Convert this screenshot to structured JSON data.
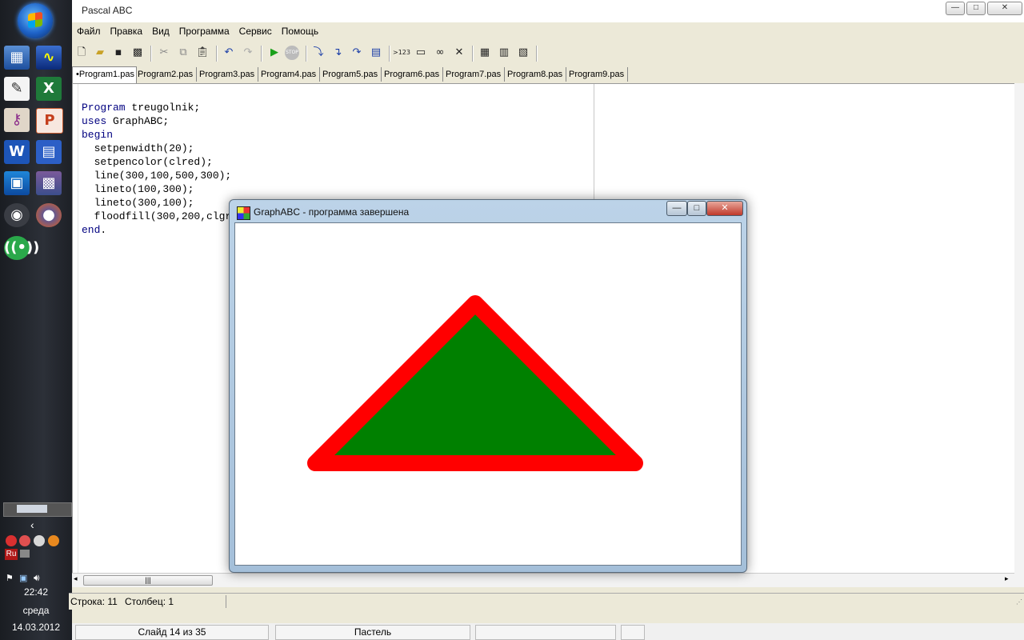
{
  "window": {
    "title": "Pascal ABC",
    "controls": {
      "minimize": "—",
      "maximize": "□",
      "close": "✕"
    }
  },
  "menu": [
    "Файл",
    "Правка",
    "Вид",
    "Программа",
    "Сервис",
    "Помощь"
  ],
  "toolbar": {
    "icons": [
      "new-file-icon",
      "open-folder-icon",
      "save-icon",
      "save-all-icon",
      "cut-icon",
      "copy-icon",
      "paste-icon",
      "undo-icon",
      "redo-icon",
      "run-icon",
      "stop-icon",
      "step-icon",
      "step-into-icon",
      "step-over-icon",
      "watch-icon",
      "eval-icon",
      "window-icon",
      "debug-icon",
      "close-icon",
      "format-icon",
      "compile-icon",
      "exe-icon"
    ],
    "label_123": ">123",
    "stop_label": "STOP"
  },
  "tabs": [
    "•Program1.pas",
    "Program2.pas",
    "Program3.pas",
    "Program4.pas",
    "Program5.pas",
    "Program6.pas",
    "Program7.pas",
    "Program8.pas",
    "Program9.pas"
  ],
  "editor": {
    "lines": [
      {
        "kw": "Program",
        "text": " treugolnik;"
      },
      {
        "kw": "uses",
        "text": " GraphABC;"
      },
      {
        "kw": "begin",
        "text": ""
      },
      {
        "kw": "",
        "text": "  setpenwidth(20);"
      },
      {
        "kw": "",
        "text": "  setpencolor(clred);"
      },
      {
        "kw": "",
        "text": "  line(300,100,500,300);"
      },
      {
        "kw": "",
        "text": "  lineto(100,300);"
      },
      {
        "kw": "",
        "text": "  lineto(300,100);"
      },
      {
        "kw": "",
        "text": "  floodfill(300,200,clgr"
      },
      {
        "kw": "end",
        "text": "."
      }
    ]
  },
  "status": {
    "row": "Строка: 11",
    "col": "Столбец: 1"
  },
  "graph_window": {
    "title": "GraphABC - программа завершена",
    "controls": {
      "minimize": "—",
      "maximize": "□",
      "close": "✕"
    },
    "shape": {
      "fill": "#008000",
      "outline": "#ff0000"
    }
  },
  "taskbar": {
    "time": "22:42",
    "day": "среда",
    "date": "14.03.2012",
    "lang": "Ru",
    "apps": [
      "monitor-icon",
      "activity-icon",
      "notepad-icon",
      "excel-icon",
      "key-icon",
      "powerpoint-icon",
      "word-icon",
      "floppy-icon",
      "screen-icon",
      "photos-icon",
      "webcam-icon",
      "firefox-icon",
      "network-icon"
    ]
  },
  "powerpoint_status": {
    "slide": "Слайд 14 из 35",
    "theme": "Пастель"
  }
}
